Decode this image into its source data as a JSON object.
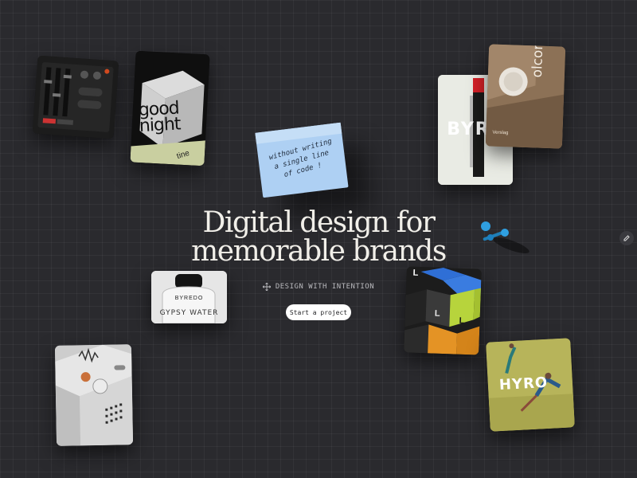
{
  "hero": {
    "line1": "Digital design for",
    "line2": "memorable brands"
  },
  "tagline": {
    "icon": "move-icon",
    "text": "DESIGN WITH INTENTION"
  },
  "cta": {
    "label": "Start a project"
  },
  "sticky_note": {
    "line1": "without writing",
    "line2": "a single line",
    "line3": "of code !"
  },
  "cards": {
    "good_night": {
      "line1": "good",
      "line2": "night",
      "small": "tine"
    },
    "byre": {
      "brand": "BYRE"
    },
    "comb": {
      "text": "olcomb",
      "small": "Verslag"
    },
    "byredo": {
      "brand": "BYREDO",
      "product": "GYPSY WATER"
    },
    "hyro": {
      "brand": "HYRO"
    },
    "cubes": {
      "glyph": "L"
    }
  },
  "colors": {
    "background": "#2a2a2e",
    "sticky_note": "#aed0f3",
    "pin": "#2f9fe0",
    "cta_bg": "#ffffff"
  }
}
